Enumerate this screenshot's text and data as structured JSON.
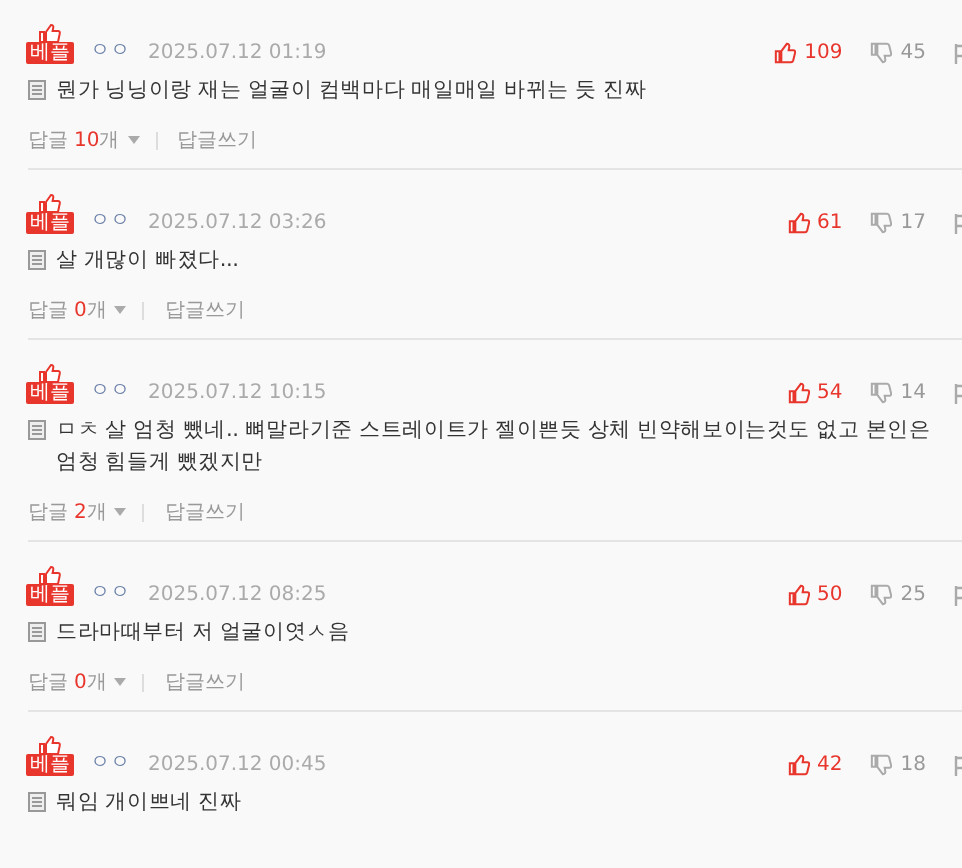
{
  "comments": [
    {
      "badge": "베플",
      "user": "ㅇㅇ",
      "date": "2025.07.12 01:19",
      "likes": "109",
      "dislikes": "45",
      "text": "뭔가 닝닝이랑 재는 얼굴이 컴백마다 매일매일 바뀌는 듯 진짜",
      "reply_label": "답글",
      "reply_count": "10",
      "reply_unit": "개",
      "write_label": "답글쓰기"
    },
    {
      "badge": "베플",
      "user": "ㅇㅇ",
      "date": "2025.07.12 03:26",
      "likes": "61",
      "dislikes": "17",
      "text": "살 개많이 빠졌다...",
      "reply_label": "답글",
      "reply_count": "0",
      "reply_unit": "개",
      "write_label": "답글쓰기"
    },
    {
      "badge": "베플",
      "user": "ㅇㅇ",
      "date": "2025.07.12 10:15",
      "likes": "54",
      "dislikes": "14",
      "text": "ㅁㅊ 살 엄청 뺐네.. 뼈말라기준 스트레이트가 젤이쁜듯 상체 빈약해보이는것도 없고 본인은 엄청 힘들게 뺐겠지만",
      "reply_label": "답글",
      "reply_count": "2",
      "reply_unit": "개",
      "write_label": "답글쓰기"
    },
    {
      "badge": "베플",
      "user": "ㅇㅇ",
      "date": "2025.07.12 08:25",
      "likes": "50",
      "dislikes": "25",
      "text": "드라마때부터 저 얼굴이엿ㅅ음",
      "reply_label": "답글",
      "reply_count": "0",
      "reply_unit": "개",
      "write_label": "답글쓰기"
    },
    {
      "badge": "베플",
      "user": "ㅇㅇ",
      "date": "2025.07.12 00:45",
      "likes": "42",
      "dislikes": "18",
      "text": "뭐임 개이쁘네 진짜"
    }
  ]
}
